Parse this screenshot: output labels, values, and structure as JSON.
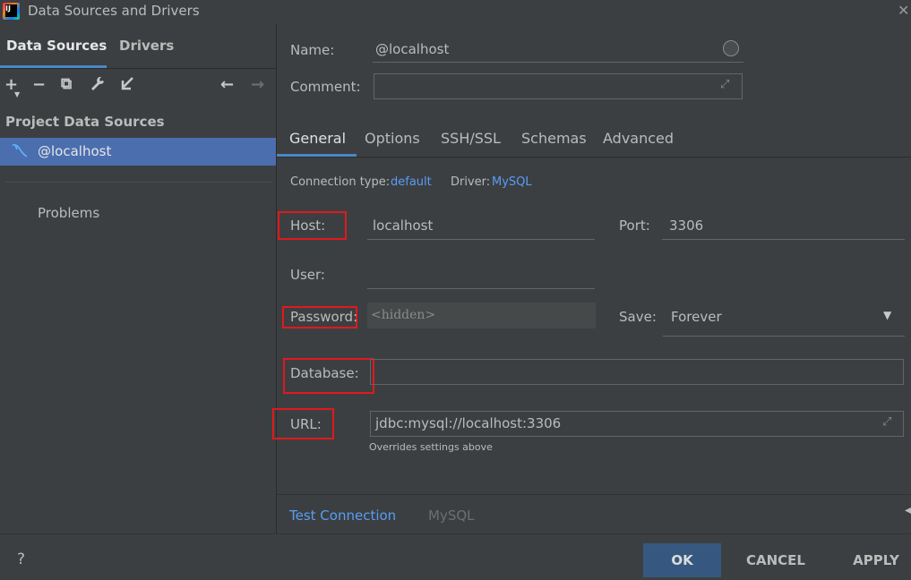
{
  "window": {
    "title": "Data Sources and Drivers",
    "icon_text": "IJ"
  },
  "left": {
    "tabs": [
      {
        "label": "Data Sources"
      },
      {
        "label": "Drivers"
      }
    ],
    "toolbar": {
      "add": "+",
      "remove": "−",
      "duplicate": "⧉",
      "wrench": "🔧",
      "import": "↙",
      "back": "←",
      "forward": "→"
    },
    "section_title": "Project Data Sources",
    "tree": [
      {
        "label": "@localhost"
      }
    ],
    "problems_label": "Problems"
  },
  "form": {
    "name_label": "Name:",
    "name_value": "@localhost",
    "comment_label": "Comment:",
    "tabs": [
      {
        "label": "General"
      },
      {
        "label": "Options"
      },
      {
        "label": "SSH/SSL"
      },
      {
        "label": "Schemas"
      },
      {
        "label": "Advanced"
      }
    ],
    "connection_type_label": "Connection type:",
    "connection_type_value": "default",
    "driver_label": "Driver:",
    "driver_value": "MySQL",
    "host_label": "Host:",
    "host_value": "localhost",
    "port_label": "Port:",
    "port_value": "3306",
    "user_label": "User:",
    "user_value": "",
    "password_label": "Password:",
    "password_placeholder": "<hidden>",
    "save_label": "Save:",
    "save_value": "Forever",
    "database_label": "Database:",
    "database_value": "",
    "url_label": "URL:",
    "url_value": "jdbc:mysql://localhost:3306",
    "url_hint": "Overrides settings above"
  },
  "bottom": {
    "test_connection": "Test Connection",
    "driver_name": "MySQL"
  },
  "footer": {
    "help": "?",
    "ok": "OK",
    "cancel": "CANCEL",
    "apply": "APPLY"
  }
}
